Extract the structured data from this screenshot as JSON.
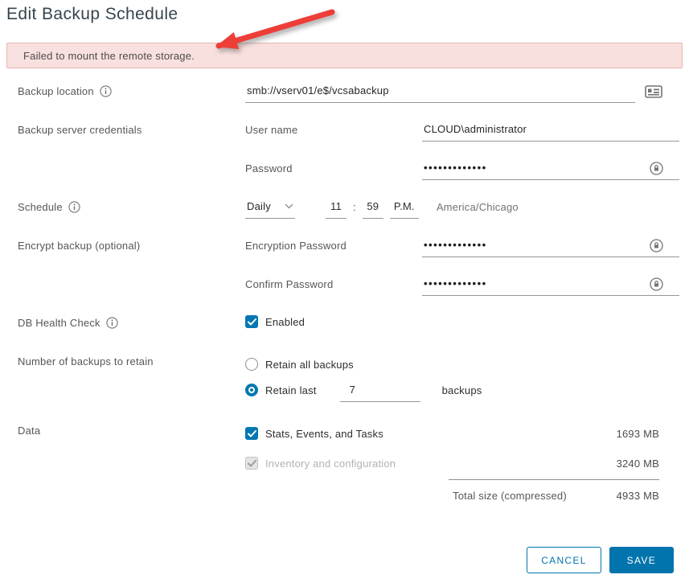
{
  "page": {
    "title": "Edit Backup Schedule"
  },
  "alert": {
    "message": "Failed to mount the remote storage."
  },
  "form": {
    "backup_location": {
      "label": "Backup location",
      "value": "smb://vserv01/e$/vcsabackup"
    },
    "credentials": {
      "label": "Backup server credentials",
      "username": {
        "label": "User name",
        "value": "CLOUD\\administrator"
      },
      "password": {
        "label": "Password",
        "value": "•••••••••••••"
      }
    },
    "schedule": {
      "label": "Schedule",
      "frequency": "Daily",
      "hour": "11",
      "separator": ":",
      "minute": "59",
      "meridiem": "P.M.",
      "timezone": "America/Chicago"
    },
    "encrypt": {
      "label": "Encrypt backup (optional)",
      "encryption_password": {
        "label": "Encryption Password",
        "value": "•••••••••••••"
      },
      "confirm_password": {
        "label": "Confirm Password",
        "value": "•••••••••••••"
      }
    },
    "db_health": {
      "label": "DB Health Check",
      "checkbox_label": "Enabled",
      "checked": true
    },
    "retention": {
      "label": "Number of backups to retain",
      "option_all": "Retain all backups",
      "option_last": "Retain last",
      "count": "7",
      "suffix": "backups"
    },
    "data": {
      "label": "Data",
      "rows": [
        {
          "label": "Stats, Events, and Tasks",
          "size": "1693 MB",
          "disabled": false
        },
        {
          "label": "Inventory and configuration",
          "size": "3240 MB",
          "disabled": true
        }
      ],
      "total_label": "Total size (compressed)",
      "total_size": "4933 MB"
    }
  },
  "actions": {
    "cancel": "CANCEL",
    "save": "SAVE"
  },
  "colors": {
    "accent": "#0274ad",
    "error_bg": "#f8e0de",
    "error_border": "#e5b5b2",
    "arrow_red": "#ee3e38"
  }
}
